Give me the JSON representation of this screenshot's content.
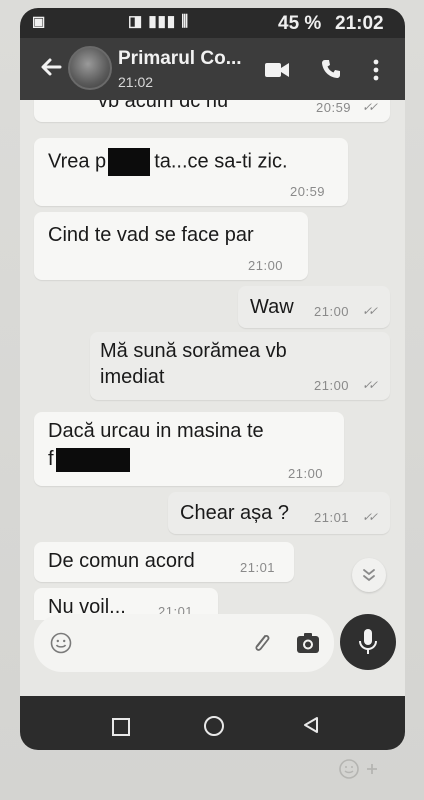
{
  "status_bar": {
    "battery_text": "45 %",
    "time": "21:02"
  },
  "header": {
    "contact_name": "Primarul Co...",
    "subtitle": "21:02"
  },
  "messages": [
    {
      "direction": "in",
      "text": "vb acum dc nu",
      "time": "20:59"
    },
    {
      "direction": "in",
      "text_before": "Vrea p",
      "text_after": "ta...ce sa-ti zic.",
      "time": "20:59"
    },
    {
      "direction": "in",
      "text": "Cind te vad se face par",
      "time": "21:00"
    },
    {
      "direction": "out",
      "text": "Waw",
      "time": "21:00"
    },
    {
      "direction": "out",
      "line1": "Mă sună sorămea vb",
      "line2": "imediat",
      "time": "21:00"
    },
    {
      "direction": "in",
      "line1": "Dacă urcau in masina te",
      "line2_before": "f",
      "time": "21:00"
    },
    {
      "direction": "out",
      "text": "Chear așa ?",
      "time": "21:01"
    },
    {
      "direction": "in",
      "text": "De comun acord",
      "time": "21:01"
    },
    {
      "direction": "in",
      "text": "Nu voil...",
      "time": "21:01"
    }
  ],
  "colors": {
    "app_bar": "#3c3c3c",
    "chat_background": "#e7e7e4",
    "incoming_bubble": "#f7f7f5",
    "outgoing_bubble": "#ececea",
    "mic_button": "#2f2f2f"
  },
  "icons": {
    "back": "back-arrow-icon",
    "video": "video-call-icon",
    "call": "phone-icon",
    "menu": "more-vert-icon",
    "emoji": "emoji-icon",
    "attach": "paperclip-icon",
    "camera": "camera-icon",
    "mic": "mic-icon",
    "scroll": "chevron-double-down-icon",
    "read_receipt": "double-check-icon"
  }
}
